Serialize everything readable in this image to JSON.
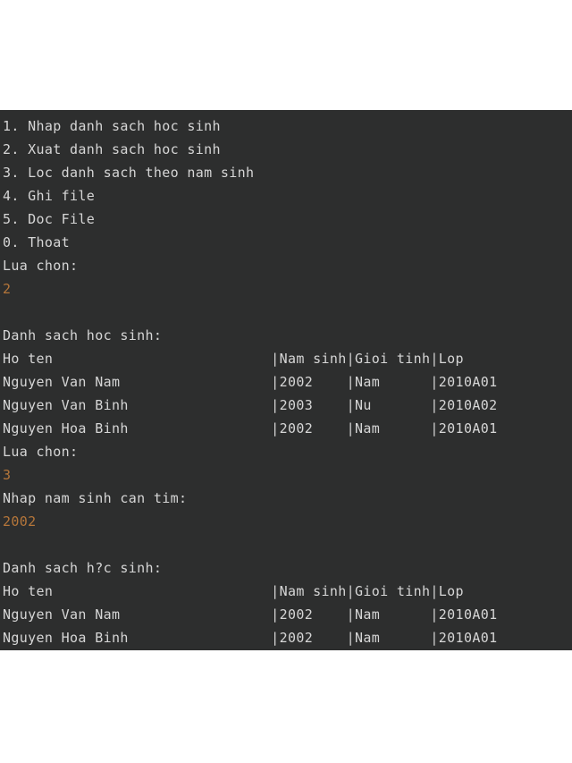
{
  "terminal": {
    "background_color": "#2d2e2e",
    "text_color": "#d6d6d6",
    "input_color": "#b5763a",
    "page_background": "#ffffff"
  },
  "menu": {
    "items": [
      "1. Nhap danh sach hoc sinh",
      "2. Xuat danh sach hoc sinh",
      "3. Loc danh sach theo nam sinh",
      "4. Ghi file",
      "5. Doc File",
      "0. Thoat"
    ]
  },
  "prompts": {
    "choice_label_1": "Lua chon:",
    "choice_value_1": "2",
    "choice_label_2": "Lua chon:",
    "choice_value_2": "3",
    "year_label": "Nhap nam sinh can tim:",
    "year_value": "2002"
  },
  "listing_all": {
    "title": "Danh sach hoc sinh:",
    "header": {
      "name": "Ho ten",
      "cols": "|Nam sinh|Gioi tinh|Lop"
    },
    "rows": [
      {
        "name": "Nguyen Van Nam",
        "cols": "|2002    |Nam      |2010A01"
      },
      {
        "name": "Nguyen Van Binh",
        "cols": "|2003    |Nu       |2010A02"
      },
      {
        "name": "Nguyen Hoa Binh",
        "cols": "|2002    |Nam      |2010A01"
      }
    ]
  },
  "listing_filtered": {
    "title": "Danh sach h?c sinh:",
    "header": {
      "name": "Ho ten",
      "cols": "|Nam sinh|Gioi tinh|Lop"
    },
    "rows": [
      {
        "name": "Nguyen Van Nam",
        "cols": "|2002    |Nam      |2010A01"
      },
      {
        "name": "Nguyen Hoa Binh",
        "cols": "|2002    |Nam      |2010A01"
      }
    ]
  }
}
